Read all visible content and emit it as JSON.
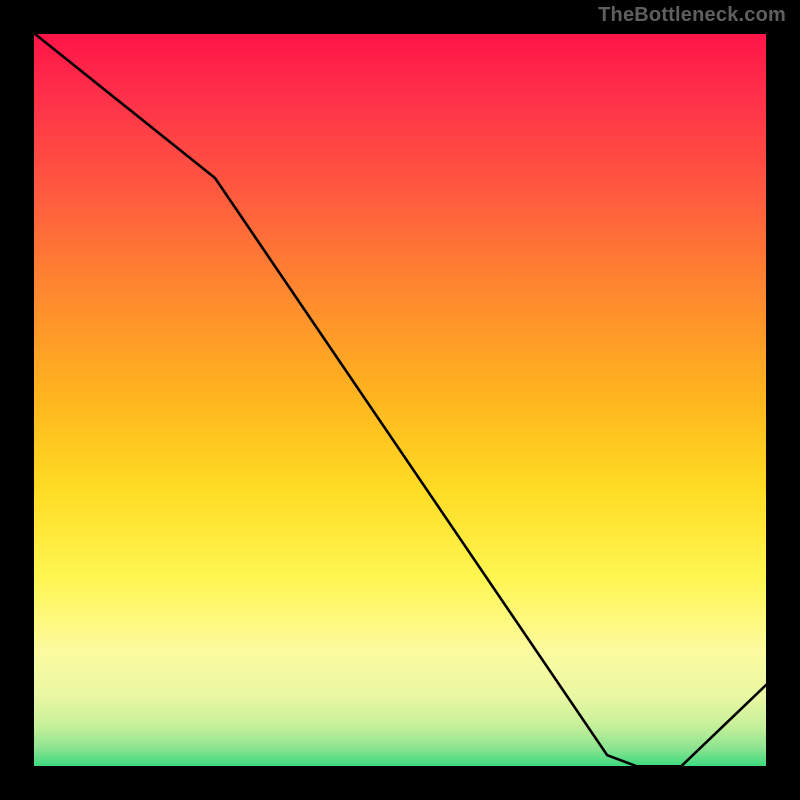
{
  "watermark": "TheBottleneck.com",
  "chart_data": {
    "type": "line",
    "title": "",
    "xlabel": "",
    "ylabel": "",
    "xlim": [
      0,
      100
    ],
    "ylim": [
      0,
      100
    ],
    "background_gradient": {
      "top": "#ff1247",
      "mid": "#ffe02a",
      "bottom": "#2bd77a"
    },
    "curve_points": [
      {
        "x": 0,
        "y": 100
      },
      {
        "x": 25,
        "y": 80
      },
      {
        "x": 78,
        "y": 2
      },
      {
        "x": 82,
        "y": 0.5
      },
      {
        "x": 88,
        "y": 0.5
      },
      {
        "x": 100,
        "y": 12
      }
    ]
  }
}
